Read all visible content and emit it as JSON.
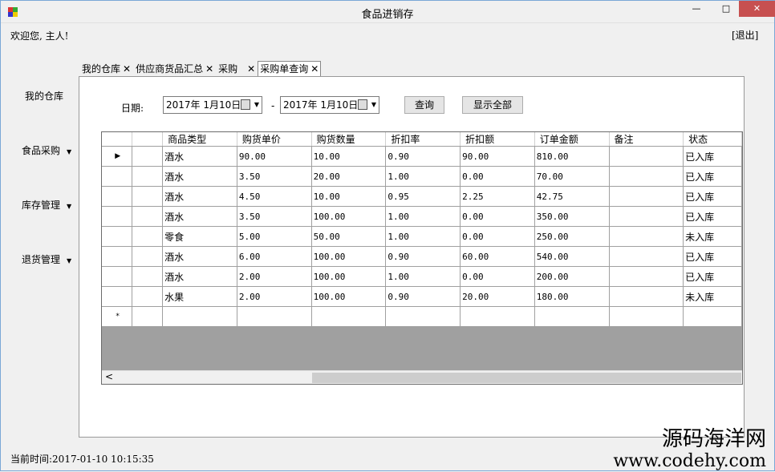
{
  "window": {
    "title": "食品进销存",
    "minimize": "—",
    "maximize": "□",
    "close": "✕"
  },
  "header": {
    "welcome": "欢迎您, 主人!",
    "exit": "[退出]"
  },
  "nav": [
    {
      "label": "我的仓库",
      "arrow": ""
    },
    {
      "label": "食品采购",
      "arrow": "▼"
    },
    {
      "label": "库存管理",
      "arrow": "▼"
    },
    {
      "label": "退货管理",
      "arrow": "▼"
    }
  ],
  "tabs": [
    {
      "label": "我的仓库",
      "close": "✕"
    },
    {
      "label": "供应商货品汇总",
      "close": "✕"
    },
    {
      "label": "采购",
      "close": "✕"
    },
    {
      "label": "采购单查询",
      "close": "✕"
    }
  ],
  "filter": {
    "date_label": "日期:",
    "date_from": "2017年  1月10日",
    "date_to": "2017年  1月10日",
    "dash": "-",
    "query_button": "查询",
    "show_all_button": "显示全部"
  },
  "table": {
    "columns": [
      "商品类型",
      "购货单价",
      "购货数量",
      "折扣率",
      "折扣额",
      "订单金额",
      "备注",
      "状态"
    ],
    "rows": [
      [
        "酒水",
        "90.00",
        "10.00",
        "0.90",
        "90.00",
        "810.00",
        "",
        "已入库"
      ],
      [
        "酒水",
        "3.50",
        "20.00",
        "1.00",
        "0.00",
        "70.00",
        "",
        "已入库"
      ],
      [
        "酒水",
        "4.50",
        "10.00",
        "0.95",
        "2.25",
        "42.75",
        "",
        "已入库"
      ],
      [
        "酒水",
        "3.50",
        "100.00",
        "1.00",
        "0.00",
        "350.00",
        "",
        "已入库"
      ],
      [
        "零食",
        "5.00",
        "50.00",
        "1.00",
        "0.00",
        "250.00",
        "",
        "未入库"
      ],
      [
        "酒水",
        "6.00",
        "100.00",
        "0.90",
        "60.00",
        "540.00",
        "",
        "已入库"
      ],
      [
        "酒水",
        "2.00",
        "100.00",
        "1.00",
        "0.00",
        "200.00",
        "",
        "已入库"
      ],
      [
        "水果",
        "2.00",
        "100.00",
        "0.90",
        "20.00",
        "180.00",
        "",
        "未入库"
      ]
    ],
    "current_row_marker": "▶",
    "new_row_marker": "*",
    "scroll_left": "<"
  },
  "status": {
    "text": "当前时间:2017-01-10 10:15:35"
  },
  "watermark": {
    "line1": "源码海洋网",
    "line2": "www.codehy.com"
  }
}
